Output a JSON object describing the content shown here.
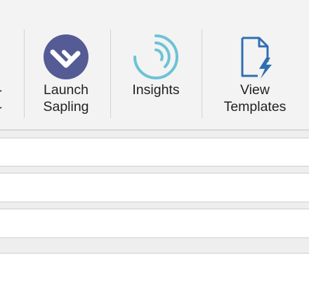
{
  "ribbon": {
    "partial_button": {
      "label_line1": "r",
      "label_line2": "r"
    },
    "buttons": [
      {
        "id": "launch-sapling",
        "label": "Launch\nSapling",
        "icon": "sapling-logo-icon"
      },
      {
        "id": "insights",
        "label": "Insights",
        "icon": "insights-icon"
      },
      {
        "id": "view-templates",
        "label": "View\nTemplates",
        "icon": "template-lightning-icon"
      }
    ]
  },
  "colors": {
    "sapling_purple": "#555b95",
    "insights_teal": "#6cc3d5",
    "template_blue": "#2f6fb2"
  }
}
